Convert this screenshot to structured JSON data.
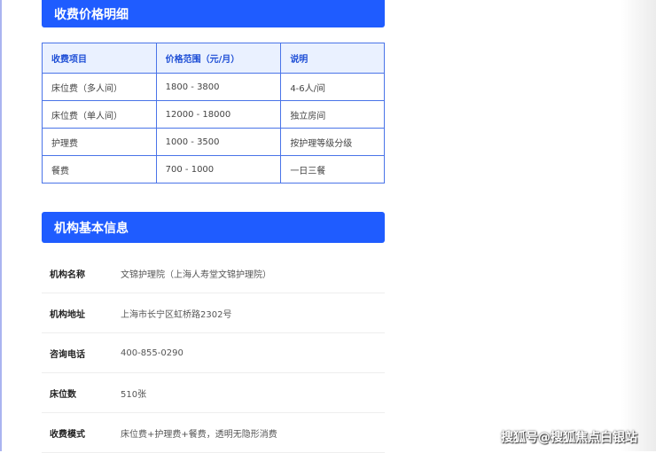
{
  "price_section": {
    "title": "收费价格明细",
    "headers": [
      "收费项目",
      "价格范围（元/月）",
      "说明"
    ],
    "rows": [
      [
        "床位费（多人间）",
        "1800 - 3800",
        "4-6人/间"
      ],
      [
        "床位费（单人间）",
        "12000 - 18000",
        "独立房间"
      ],
      [
        "护理费",
        "1000 - 3500",
        "按护理等级分级"
      ],
      [
        "餐费",
        "700 - 1000",
        "一日三餐"
      ]
    ]
  },
  "info_section": {
    "title": "机构基本信息",
    "rows": [
      {
        "label": "机构名称",
        "value": "文锦护理院（上海人寿堂文锦护理院）"
      },
      {
        "label": "机构地址",
        "value": "上海市长宁区虹桥路2302号"
      },
      {
        "label": "咨询电话",
        "value": "400-855-0290"
      },
      {
        "label": "床位数",
        "value": "510张"
      },
      {
        "label": "收费模式",
        "value": "床位费+护理费+餐费，透明无隐形消费"
      }
    ]
  },
  "watermark": "搜狐号@搜狐焦点白银站",
  "colors": {
    "accent": "#1f5cff",
    "table_border": "#4a74e8",
    "header_bg": "#eaf1ff"
  }
}
